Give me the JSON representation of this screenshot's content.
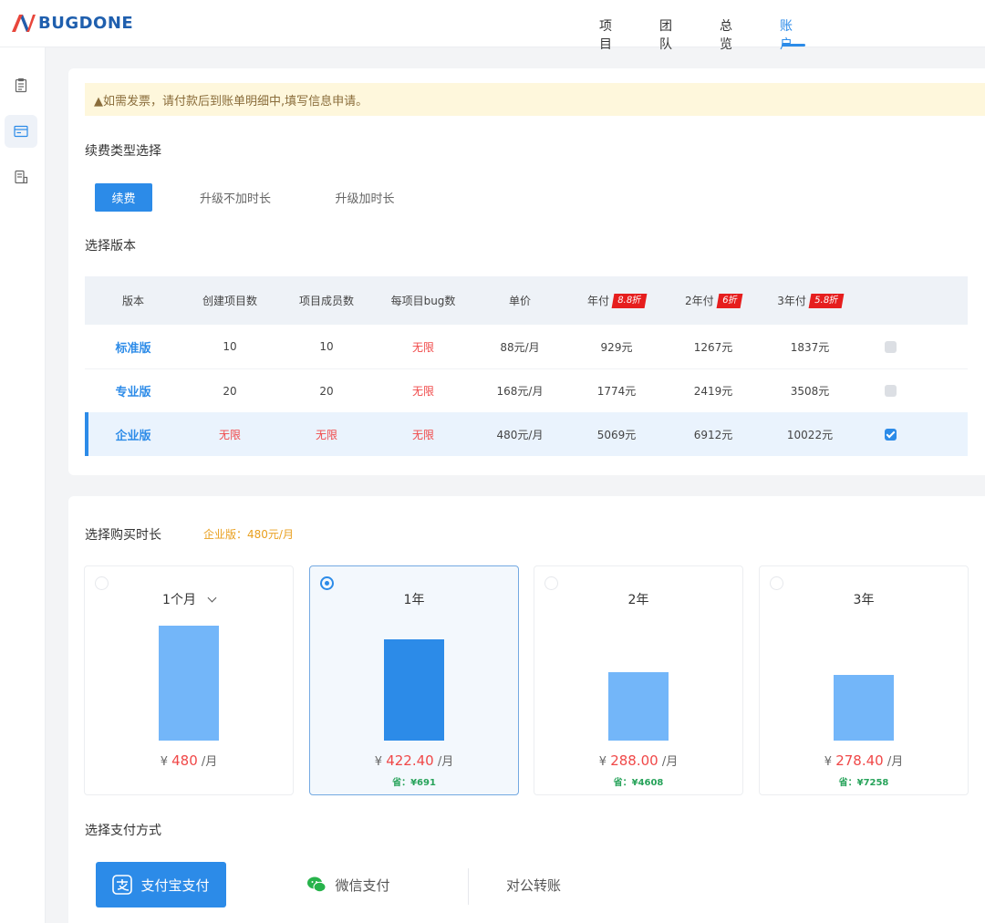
{
  "brand": {
    "name": "BUGDONE"
  },
  "nav": [
    {
      "label": "项目",
      "active": false
    },
    {
      "label": "团队",
      "active": false
    },
    {
      "label": "总览",
      "active": false
    },
    {
      "label": "账户",
      "active": true
    }
  ],
  "sidebar": [
    {
      "icon": "clipboard-icon",
      "active": false
    },
    {
      "icon": "card-icon",
      "active": true
    },
    {
      "icon": "document-chart-icon",
      "active": false
    }
  ],
  "notice": "▲如需发票，请付款后到账单明细中,填写信息申请。",
  "renew_type": {
    "title": "续费类型选择",
    "options": [
      {
        "label": "续费",
        "active": true
      },
      {
        "label": "升级不加时长",
        "active": false
      },
      {
        "label": "升级加时长",
        "active": false
      }
    ]
  },
  "plans": {
    "title": "选择版本",
    "headers": [
      "版本",
      "创建项目数",
      "项目成员数",
      "每项目bug数",
      "单价",
      "年付",
      "2年付",
      "3年付"
    ],
    "discounts": [
      "8.8折",
      "6折",
      "5.8折"
    ],
    "rows": [
      {
        "name": "标准版",
        "projects": "10",
        "members": "10",
        "bugs": "无限",
        "unit": "88元/月",
        "y1": "929元",
        "y2": "1267元",
        "y3": "1837元",
        "checked": false
      },
      {
        "name": "专业版",
        "projects": "20",
        "members": "20",
        "bugs": "无限",
        "unit": "168元/月",
        "y1": "1774元",
        "y2": "2419元",
        "y3": "3508元",
        "checked": false
      },
      {
        "name": "企业版",
        "projects": "无限",
        "members": "无限",
        "bugs": "无限",
        "unit": "480元/月",
        "y1": "5069元",
        "y2": "6912元",
        "y3": "10022元",
        "checked": true
      }
    ]
  },
  "duration": {
    "title": "选择购买时长",
    "tag": "企业版：480元/月",
    "currency": "¥",
    "unit": "/月",
    "save_prefix": "省：¥",
    "options": [
      {
        "label": "1个月",
        "price": "480",
        "save": "",
        "bar_fraction": 0.84,
        "selected": false,
        "dropdown": true
      },
      {
        "label": "1年",
        "price": "422.40",
        "save": "691",
        "bar_fraction": 0.74,
        "selected": true,
        "dropdown": false
      },
      {
        "label": "2年",
        "price": "288.00",
        "save": "4608",
        "bar_fraction": 0.5,
        "selected": false,
        "dropdown": false
      },
      {
        "label": "3年",
        "price": "278.40",
        "save": "7258",
        "bar_fraction": 0.48,
        "selected": false,
        "dropdown": false
      }
    ]
  },
  "payment": {
    "title": "选择支付方式",
    "options": [
      {
        "label": "支付宝支付",
        "icon": "alipay-icon",
        "active": true
      },
      {
        "label": "微信支付",
        "icon": "wechat-icon",
        "active": false
      },
      {
        "label": "对公转账",
        "icon": "",
        "active": false
      }
    ]
  }
}
